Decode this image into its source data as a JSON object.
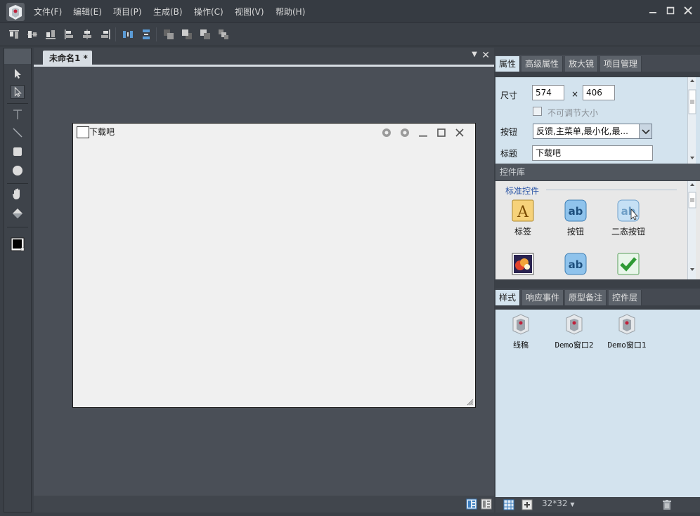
{
  "menu": {
    "items": [
      "文件(F)",
      "编辑(E)",
      "项目(P)",
      "生成(B)",
      "操作(C)",
      "视图(V)",
      "帮助(H)"
    ]
  },
  "document": {
    "tab_label": "未命名1 *"
  },
  "design_window": {
    "title": "下载吧"
  },
  "right_panel": {
    "top_tabs": [
      "属性",
      "高级属性",
      "放大镜",
      "项目管理"
    ],
    "props": {
      "size_label": "尺寸",
      "width": "574",
      "times": "×",
      "height": "406",
      "non_resizable_label": "不可调节大小",
      "buttons_label": "按钮",
      "buttons_value": "反馈,主菜单,最小化,最...",
      "title_label": "标题",
      "title_value": "下载吧"
    },
    "library_header": "控件库",
    "library_category": "标准控件",
    "library_items": [
      "标签",
      "按钮",
      "二态按钮"
    ],
    "bottom_tabs": [
      "样式",
      "响应事件",
      "原型备注",
      "控件层"
    ],
    "styles": [
      "线稿",
      "Demo窗口2",
      "Demo窗口1"
    ],
    "icon_size": "32*32"
  },
  "colors": {
    "accent": "#d3e3ee",
    "dark_bg": "#3b4047"
  }
}
